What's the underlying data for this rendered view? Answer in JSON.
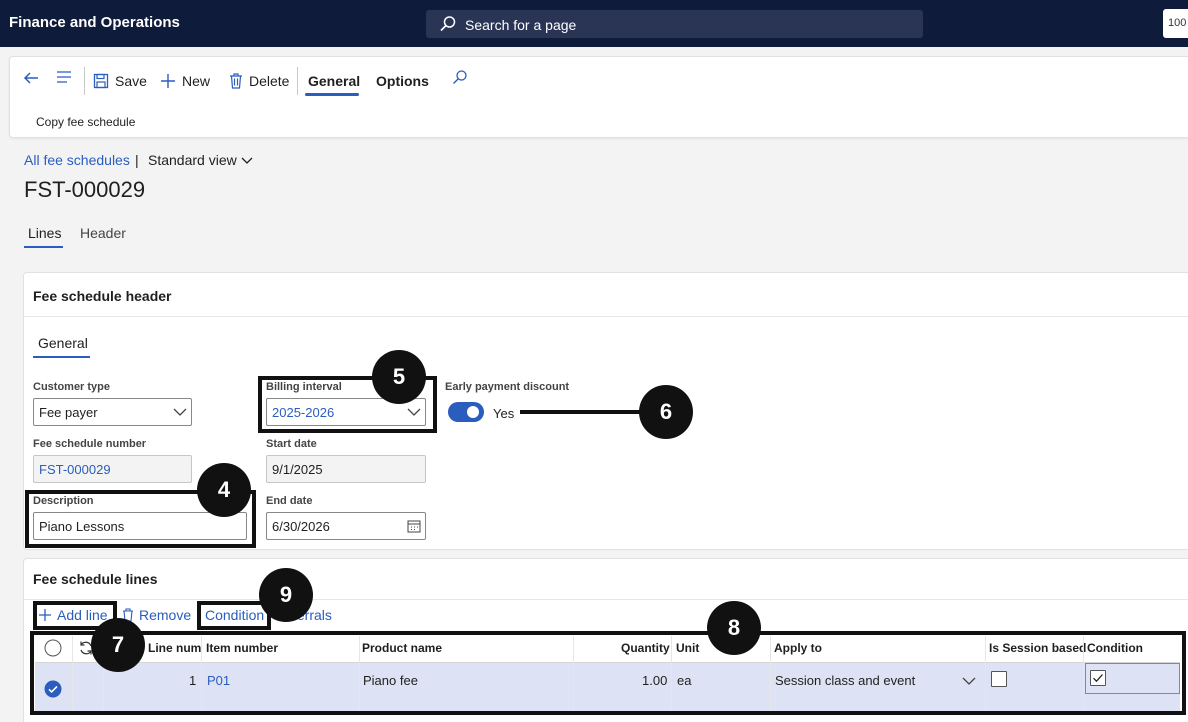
{
  "app": {
    "title": "Finance and Operations",
    "search_placeholder": "Search for a page",
    "user_badge": "100"
  },
  "action_pane": {
    "save": "Save",
    "new": "New",
    "delete": "Delete",
    "tab_general": "General",
    "tab_options": "Options",
    "sub_action": "Copy fee schedule"
  },
  "breadcrumb": {
    "link": "All fee schedules",
    "separator": "|",
    "view": "Standard view"
  },
  "page_title": "FST-000029",
  "pivots": {
    "lines": "Lines",
    "header": "Header"
  },
  "header_card": {
    "title": "Fee schedule header",
    "tab": "General",
    "customer_type": {
      "label": "Customer type",
      "value": "Fee payer"
    },
    "fee_schedule_number": {
      "label": "Fee schedule number",
      "value": "FST-000029"
    },
    "description": {
      "label": "Description",
      "value": "Piano Lessons"
    },
    "billing_interval": {
      "label": "Billing interval",
      "value": "2025-2026"
    },
    "start_date": {
      "label": "Start date",
      "value": "9/1/2025"
    },
    "end_date": {
      "label": "End date",
      "value": "6/30/2026"
    },
    "early_payment": {
      "label": "Early payment discount",
      "value": "Yes"
    }
  },
  "lines_card": {
    "title": "Fee schedule lines",
    "toolbar": {
      "add_line": "Add line",
      "remove": "Remove",
      "condition": "Condition",
      "referrals": "ferrals"
    },
    "columns": [
      "Line num",
      "Item number",
      "Product name",
      "Quantity",
      "Unit",
      "Apply to",
      "Is Session based",
      "Condition"
    ],
    "rows": [
      {
        "line_num": "1",
        "item_number": "P01",
        "product_name": "Piano fee",
        "quantity": "1.00",
        "unit": "ea",
        "apply_to": "Session class and event",
        "is_session_based": false,
        "condition": true
      }
    ]
  },
  "callouts": {
    "c4": "4",
    "c5": "5",
    "c6": "6",
    "c7": "7",
    "c8": "8",
    "c9": "9"
  },
  "colors": {
    "accent": "#2a5dbd",
    "topbar": "#0f1b3b",
    "row_selected": "#dde3f4"
  }
}
